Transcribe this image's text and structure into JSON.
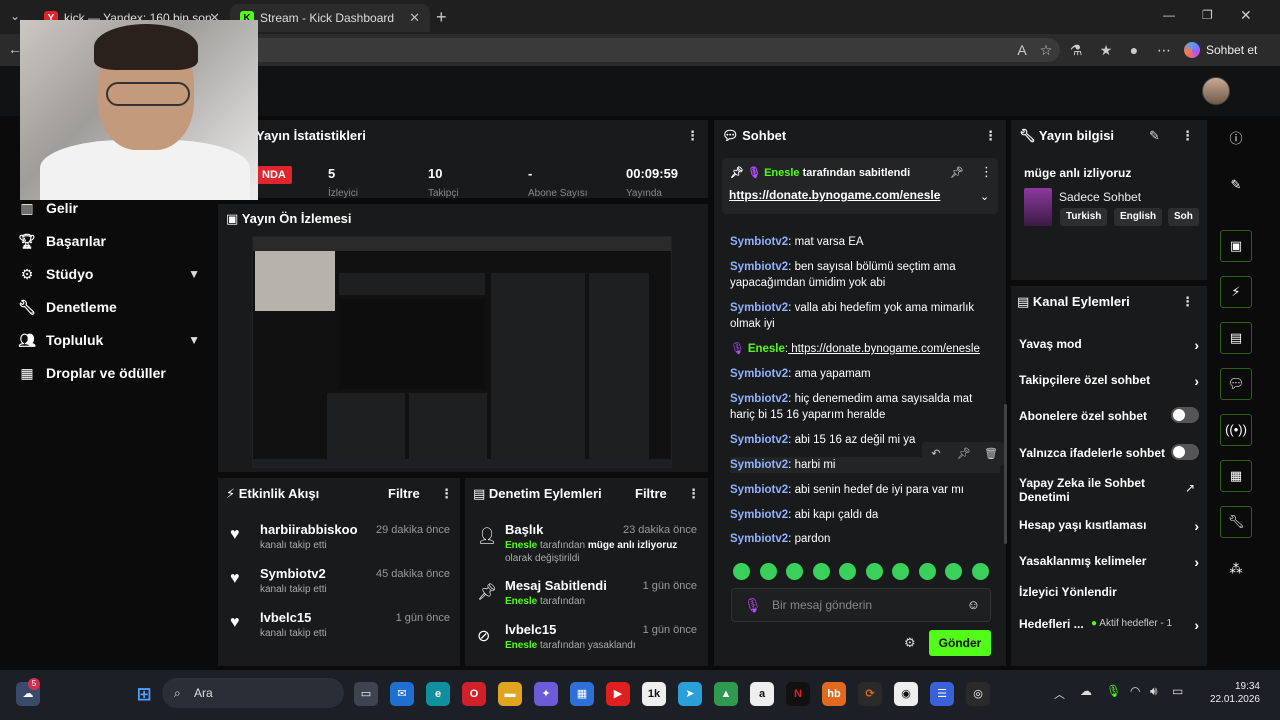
{
  "browser": {
    "tabs": [
      {
        "label": "kick — Yandex: 160 bin sonuç bulu",
        "favicon": "Y",
        "color": "#e0242e"
      },
      {
        "label": "Stream - Kick Dashboard",
        "favicon": "K",
        "color": "#53fc18"
      }
    ],
    "url_fragment": "m",
    "copilot_label": "Sohbet et"
  },
  "sidebar": {
    "items": [
      {
        "label": "Gelir",
        "icon": "bar-chart-icon"
      },
      {
        "label": "Başarılar",
        "icon": "trophy-icon"
      },
      {
        "label": "Stüdyo",
        "icon": "studio-icon"
      },
      {
        "label": "Denetleme",
        "icon": "wrench-icon"
      },
      {
        "label": "Topluluk",
        "icon": "community-icon"
      },
      {
        "label": "Droplar ve ödüller",
        "icon": "drops-icon"
      }
    ]
  },
  "stats": {
    "title": "Yayın İstatistikleri",
    "live_badge": "NDA",
    "viewers": "5",
    "viewers_label": "İzleyici",
    "followers": "10",
    "followers_label": "Takipçi",
    "subs": "-",
    "subs_label": "Abone Sayısı",
    "uptime": "00:09:59",
    "uptime_label": "Yayında"
  },
  "preview": {
    "title": "Yayın Ön İzlemesi"
  },
  "activity": {
    "title": "Etkinlik Akışı",
    "filter": "Filtre",
    "items": [
      {
        "name": "harbiirabbiskoo",
        "sub": "kanalı takip etti",
        "time": "29 dakika önce"
      },
      {
        "name": "Symbiotv2",
        "sub": "kanalı takip etti",
        "time": "45 dakika önce"
      },
      {
        "name": "lvbelc15",
        "sub": "kanalı takip etti",
        "time": "1 gün önce"
      }
    ]
  },
  "moderation": {
    "title": "Denetim Eylemleri",
    "filter": "Filtre",
    "items": [
      {
        "name": "Başlık",
        "actor": "Enesle",
        "sub": " tarafından ",
        "bold": "müge anlı izliyoruz",
        "sub2": "olarak değiştirildi",
        "time": "23 dakika önce"
      },
      {
        "name": "Mesaj Sabitlendi",
        "actor": "Enesle",
        "sub": " tarafından",
        "time": "1 gün önce"
      },
      {
        "name": "lvbelc15",
        "actor": "Enesle",
        "sub": " tarafından yasaklandı",
        "time": "1 gün önce"
      }
    ]
  },
  "chat": {
    "title": "Sohbet",
    "pinned_by": "Enesle",
    "pinned_suffix": " tarafından sabitlendi",
    "pinned_link": "https://donate.bynogame.com/enesle",
    "messages": [
      {
        "user": "Symbiotv2",
        "text": " mat varsa EA"
      },
      {
        "user": "Symbiotv2",
        "text": " ben sayısal bölümü seçtim ama yapacağımdan ümidim yok abi"
      },
      {
        "user": "Symbiotv2",
        "text": " valla abi hedefim yok ama mimarlık olmak iyi"
      },
      {
        "user": "Enesle",
        "text": " https://donate.bynogame.com/enesle"
      },
      {
        "user": "Symbiotv2",
        "text": " ama yapamam"
      },
      {
        "user": "Symbiotv2",
        "text": " hiç denemedim ama sayısalda mat hariç bi 15 16 yaparım heralde"
      },
      {
        "user": "Symbiotv2",
        "text": " abi 15 16 az değil mi ya"
      },
      {
        "user": "Symbiotv2",
        "text": " harbi mi"
      },
      {
        "user": "Symbiotv2",
        "text": " abi senin hedef de iyi para var mı"
      },
      {
        "user": "Symbiotv2",
        "text": " abi kapı çaldı da"
      },
      {
        "user": "Symbiotv2",
        "text": " pardon"
      }
    ],
    "input_placeholder": "Bir mesaj gönderin",
    "send_label": "Gönder"
  },
  "stream_info": {
    "title": "Yayın bilgisi",
    "stream_title": "müge anlı izliyoruz",
    "category": "Sadece Sohbet",
    "tags": [
      "Turkish",
      "English",
      "Soh"
    ]
  },
  "channel_actions": {
    "title": "Kanal Eylemleri",
    "items": [
      {
        "label": "Yavaş mod",
        "type": "arrow"
      },
      {
        "label": "Takipçilere özel sohbet",
        "type": "arrow"
      },
      {
        "label": "Abonelere özel sohbet",
        "type": "toggle"
      },
      {
        "label": "Yalnızca ifadelerle sohbet",
        "type": "toggle"
      },
      {
        "label": "Yapay Zeka ile Sohbet Denetimi",
        "type": "ext"
      },
      {
        "label": "Hesap yaşı kısıtlaması",
        "type": "arrow"
      },
      {
        "label": "Yasaklanmış kelimeler",
        "type": "arrow"
      },
      {
        "label": "İzleyici Yönlendir",
        "type": "none"
      },
      {
        "label": "Hedefleri ...",
        "type": "arrow",
        "extra": "Aktif hedefler - 1"
      }
    ]
  },
  "taskbar": {
    "search_label": "Ara",
    "time": "19:34",
    "date": "22.01.2026",
    "badge": "5"
  },
  "colors": {
    "accent": "#53fc18",
    "panel": "#191a1b",
    "username": "#8fb2ff"
  }
}
